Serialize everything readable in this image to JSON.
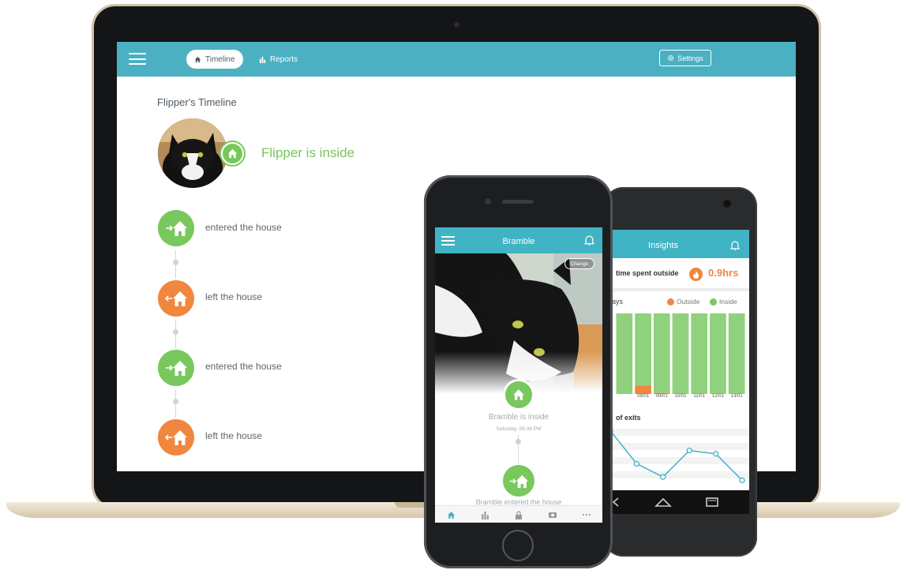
{
  "laptop": {
    "header": {
      "tabs": [
        {
          "label": "Timeline",
          "active": true,
          "icon": "home-icon"
        },
        {
          "label": "Reports",
          "active": false,
          "icon": "bar-chart-icon"
        }
      ],
      "settings_label": "Settings"
    },
    "page_title": "Flipper's Timeline",
    "status": "Flipper is inside",
    "events": [
      {
        "label": "entered the house",
        "type": "in"
      },
      {
        "label": "left the house",
        "type": "out"
      },
      {
        "label": "entered the house",
        "type": "in"
      },
      {
        "label": "left the house",
        "type": "out"
      }
    ]
  },
  "iphone": {
    "title": "Bramble",
    "change_label": "Change",
    "status": "Bramble is inside",
    "time": "Saturday, 06:34 PM",
    "event_partial": "Bramble entered the house"
  },
  "android": {
    "title": "Insights",
    "summary_label": "time spent outside",
    "summary_value": "0.9hrs",
    "days_label": "ays",
    "legend": [
      {
        "label": "Outside",
        "color": "#f1863f"
      },
      {
        "label": "Inside",
        "color": "#78c85d"
      }
    ],
    "exits_label": "of exits"
  },
  "colors": {
    "header": "#4bb0c2",
    "inside": "#78c85d",
    "outside": "#f1863f"
  },
  "chart_data": {
    "type": "bar",
    "categories": [
      "",
      "",
      "09/01",
      "10/01",
      "11/01",
      "12/01",
      "13/01"
    ],
    "category_labels_visible": [
      "08/01",
      "09/01",
      "10/01",
      "11/01",
      "12/01",
      "13/01"
    ],
    "series": [
      {
        "name": "Inside",
        "values": [
          24,
          21.5,
          23.7,
          24,
          24,
          24,
          24
        ]
      },
      {
        "name": "Outside",
        "values": [
          0,
          2.5,
          0.3,
          0,
          0,
          0,
          0
        ]
      }
    ],
    "ylim": [
      0,
      24
    ],
    "line": {
      "values": [
        9,
        4,
        2,
        6,
        5.5,
        1.5
      ]
    }
  }
}
